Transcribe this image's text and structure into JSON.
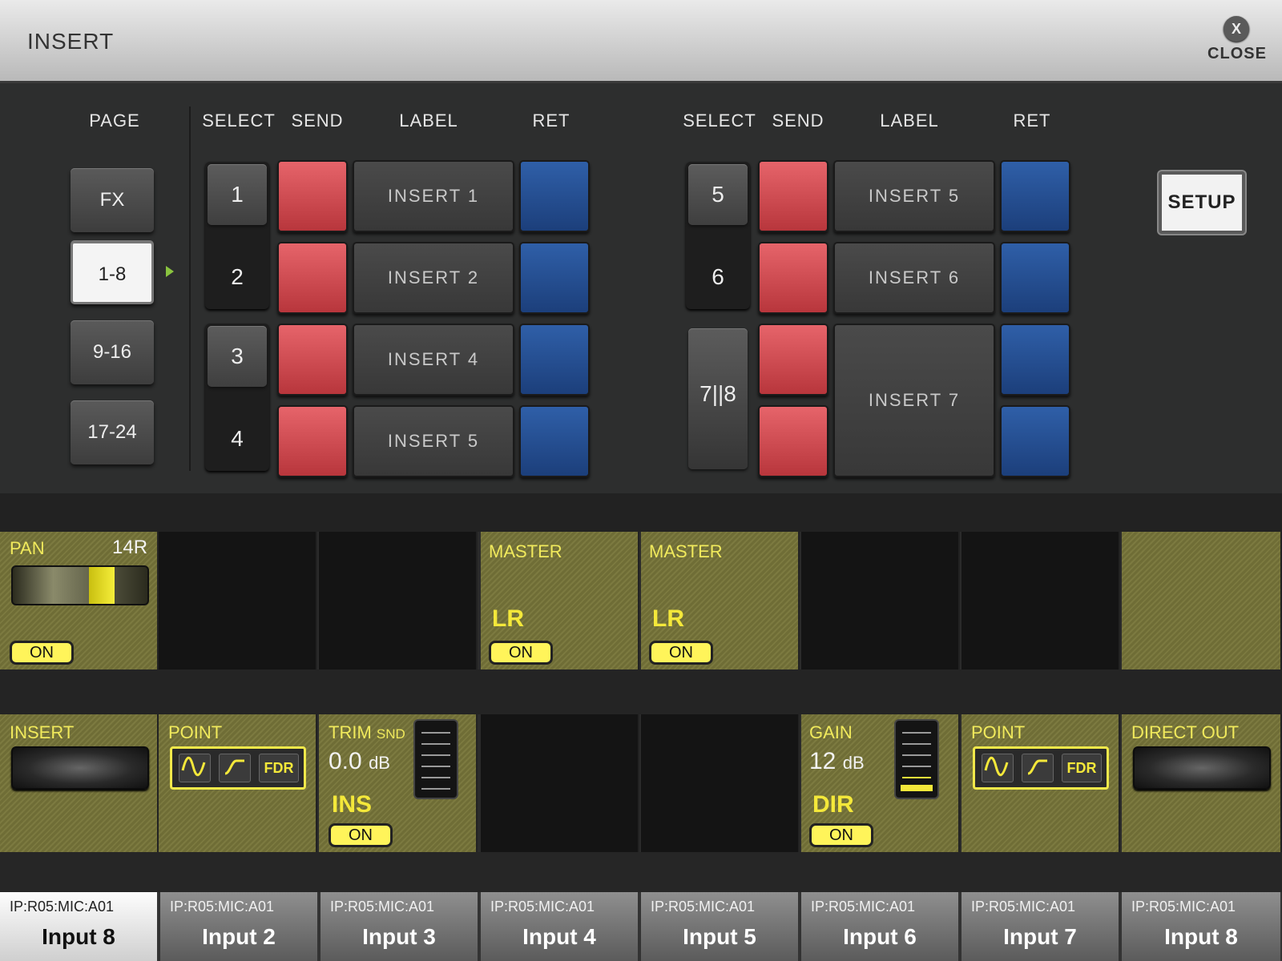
{
  "header": {
    "title": "INSERT",
    "close_icon": "X",
    "close_label": "CLOSE"
  },
  "columns": {
    "page": "PAGE",
    "select": "SELECT",
    "send": "SEND",
    "label": "LABEL",
    "ret": "RET"
  },
  "pages": [
    "FX",
    "1-8",
    "9-16",
    "17-24"
  ],
  "selected_page": "1-8",
  "left_bank": {
    "selects": [
      "1",
      "2",
      "3",
      "4"
    ],
    "labels": [
      "INSERT 1",
      "INSERT 2",
      "INSERT 4",
      "INSERT 5"
    ]
  },
  "right_bank": {
    "selects": [
      "5",
      "6",
      "7||8"
    ],
    "labels": [
      "INSERT 5",
      "INSERT 6",
      "INSERT 7"
    ]
  },
  "setup_label": "SETUP",
  "colors": {
    "send": "#d24a50",
    "ret": "#2a55a0",
    "accent": "#f4e83a",
    "olive": "#7c7a40"
  },
  "row1": {
    "pan": {
      "label": "PAN",
      "value": "14R",
      "on": "ON",
      "level": 0.7
    },
    "master1": {
      "label": "MASTER",
      "bus": "LR",
      "on": "ON"
    },
    "master2": {
      "label": "MASTER",
      "bus": "LR",
      "on": "ON"
    }
  },
  "row2": {
    "insert": {
      "label": "INSERT"
    },
    "point1": {
      "label": "POINT",
      "fdr": "FDR"
    },
    "trim": {
      "label": "TRIM",
      "sub": "SND",
      "value": "0.0",
      "unit": "dB",
      "mode": "INS",
      "on": "ON"
    },
    "gain": {
      "label": "GAIN",
      "value": "12",
      "unit": "dB",
      "mode": "DIR",
      "on": "ON"
    },
    "point2": {
      "label": "POINT",
      "fdr": "FDR"
    },
    "direct": {
      "label": "DIRECT OUT"
    }
  },
  "channels": [
    {
      "source": "IP:R05:MIC:A01",
      "name": "Input 8"
    },
    {
      "source": "IP:R05:MIC:A01",
      "name": "Input 2"
    },
    {
      "source": "IP:R05:MIC:A01",
      "name": "Input 3"
    },
    {
      "source": "IP:R05:MIC:A01",
      "name": "Input 4"
    },
    {
      "source": "IP:R05:MIC:A01",
      "name": "Input 5"
    },
    {
      "source": "IP:R05:MIC:A01",
      "name": "Input 6"
    },
    {
      "source": "IP:R05:MIC:A01",
      "name": "Input 7"
    },
    {
      "source": "IP:R05:MIC:A01",
      "name": "Input 8"
    }
  ]
}
